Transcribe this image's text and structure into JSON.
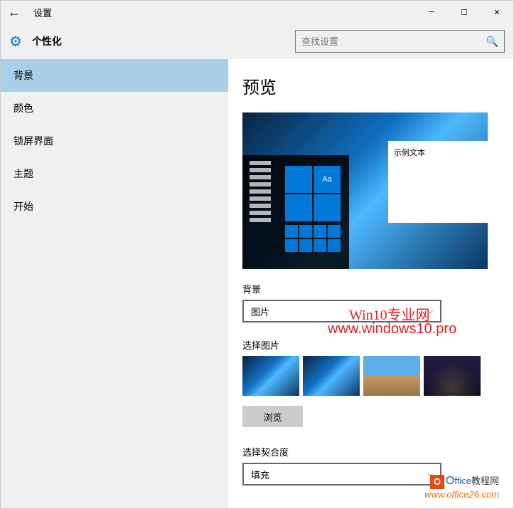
{
  "titlebar": {
    "title": "设置"
  },
  "header": {
    "section": "个性化",
    "search_placeholder": "查找设置"
  },
  "sidebar": {
    "items": [
      {
        "label": "背景",
        "active": true
      },
      {
        "label": "颜色",
        "active": false
      },
      {
        "label": "锁屏界面",
        "active": false
      },
      {
        "label": "主题",
        "active": false
      },
      {
        "label": "开始",
        "active": false
      }
    ]
  },
  "main": {
    "preview_title": "预览",
    "sample_text": "示例文本",
    "tile_text": "Aa",
    "background_label": "背景",
    "background_value": "图片",
    "choose_picture_label": "选择图片",
    "browse_label": "浏览",
    "fit_label": "选择契合度",
    "fit_value": "填充"
  },
  "watermark": {
    "line1": "Win10专业网",
    "line2": "www.windows10.pro"
  },
  "footer": {
    "brand_o": "O",
    "brand_rest": "ffice",
    "brand_cn": "教程网",
    "url": "www.office26.com"
  }
}
